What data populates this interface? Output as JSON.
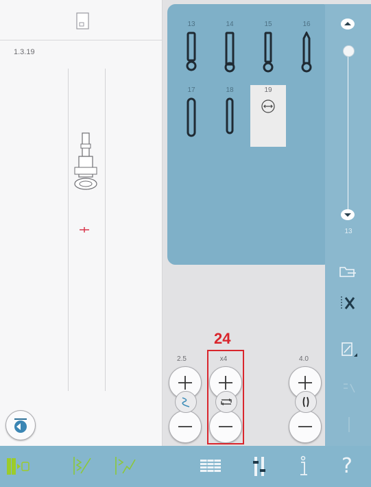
{
  "stitch_preview": {
    "code": "1.3.19"
  },
  "stitch_menu": {
    "stitches": [
      {
        "num": "13",
        "selected": false
      },
      {
        "num": "14",
        "selected": false
      },
      {
        "num": "15",
        "selected": false
      },
      {
        "num": "16",
        "selected": false
      },
      {
        "num": "17",
        "selected": false
      },
      {
        "num": "18",
        "selected": false
      },
      {
        "num": "19",
        "selected": true
      }
    ],
    "scroll_count": "13"
  },
  "controls": {
    "width_value": "2.5",
    "repeat_value": "x4",
    "length_value": "4.0",
    "callout_number": "24"
  },
  "toolbar": {
    "icons": [
      "sewing-mode-icon",
      "stitch-edit-icon",
      "stitch-program-icon",
      "menu-grid-icon",
      "settings-icon",
      "info-icon",
      "help-icon"
    ],
    "help_label": "?"
  },
  "colors": {
    "accent_blue": "#7fb0c8",
    "toolbar_blue": "#85b6cd",
    "active_green": "#9ccc2a",
    "highlight_red": "#d9252c"
  }
}
